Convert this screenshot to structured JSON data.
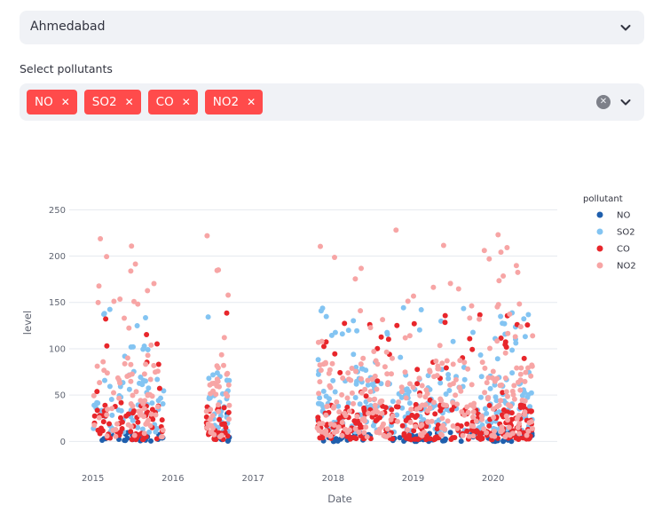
{
  "city_select": {
    "value": "Ahmedabad",
    "icon": "chevron-down-icon"
  },
  "pollutant_select": {
    "label": "Select pollutants",
    "tags": [
      {
        "label": "NO",
        "remove": "✕"
      },
      {
        "label": "SO2",
        "remove": "✕"
      },
      {
        "label": "CO",
        "remove": "✕"
      },
      {
        "label": "NO2",
        "remove": "✕"
      }
    ],
    "clear_icon": "clear-all-icon",
    "dropdown_icon": "chevron-down-icon"
  },
  "chart_data": {
    "type": "scatter",
    "xlabel": "Date",
    "ylabel": "level",
    "xlim": [
      "2014-09-15",
      "2020-10-20"
    ],
    "ylim": [
      -14,
      280
    ],
    "x_ticks": [
      "2015",
      "2016",
      "2017",
      "2018",
      "2019",
      "2020"
    ],
    "y_ticks": [
      0,
      50,
      100,
      150,
      200,
      250
    ],
    "grid": "horizontal",
    "legend": {
      "title": "pollutant",
      "placement": "right"
    },
    "series": [
      {
        "name": "NO",
        "color": "#1f5fad"
      },
      {
        "name": "SO2",
        "color": "#83c4f2"
      },
      {
        "name": "CO",
        "color": "#e8262b"
      },
      {
        "name": "NO2",
        "color": "#f7a5a5"
      }
    ]
  }
}
